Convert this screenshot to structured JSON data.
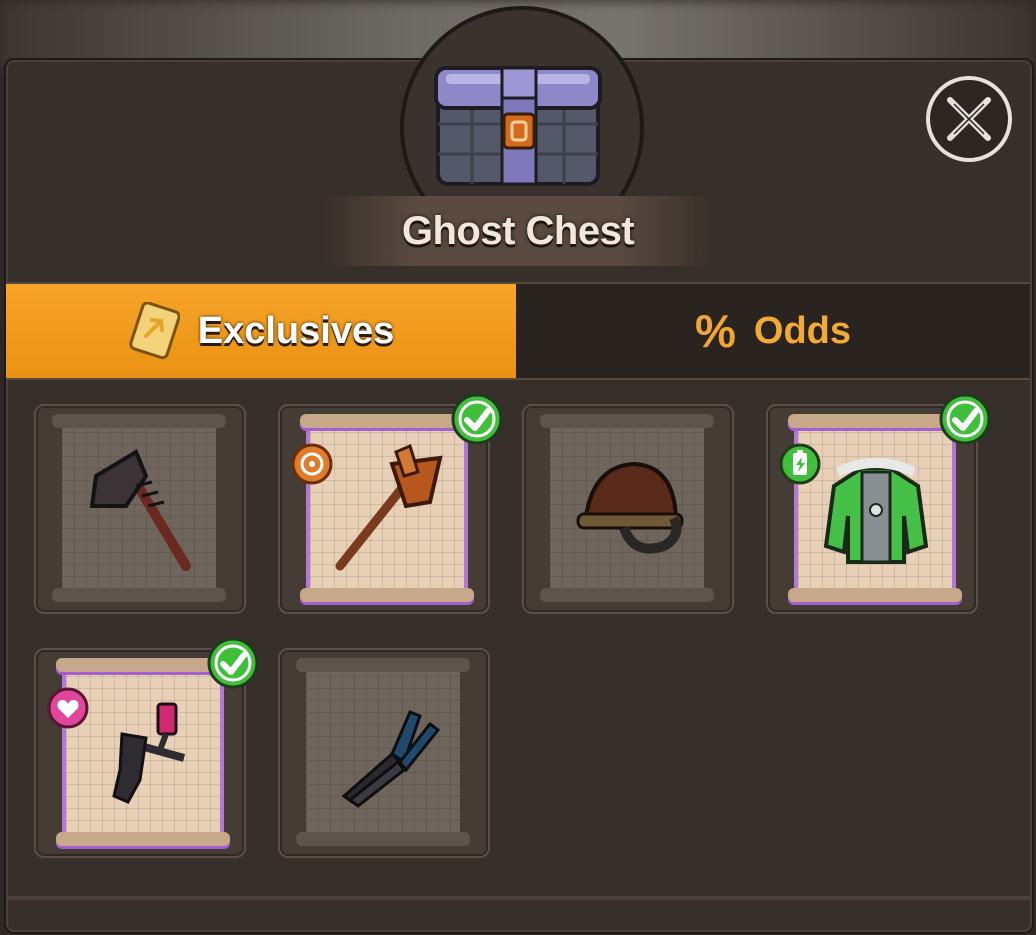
{
  "dialog": {
    "title": "Ghost Chest",
    "close_icon": "close-x-icon",
    "chest_icon": "ghost-chest-icon"
  },
  "tabs": [
    {
      "label": "Exclusives",
      "icon": "scroll-card-icon",
      "active": true
    },
    {
      "label": "Odds",
      "icon": "percent-icon",
      "prefix": "%",
      "active": false
    }
  ],
  "items": [
    {
      "name": "dark-axe",
      "rarity": "common",
      "owned": false,
      "badge": null
    },
    {
      "name": "bronze-axe",
      "rarity": "epic",
      "owned": true,
      "badge": "target-badge-icon"
    },
    {
      "name": "leather-helmet",
      "rarity": "common",
      "owned": false,
      "badge": null
    },
    {
      "name": "green-armor-jacket",
      "rarity": "epic",
      "owned": true,
      "badge": "battery-badge-icon"
    },
    {
      "name": "pink-spray-gun",
      "rarity": "epic",
      "owned": true,
      "badge": "heart-hand-badge-icon"
    },
    {
      "name": "pliers",
      "rarity": "common",
      "owned": false,
      "badge": null
    }
  ],
  "colors": {
    "accent_orange": "#ea9213",
    "epic_purple": "#b178d6",
    "owned_green": "#3fbf3a"
  }
}
